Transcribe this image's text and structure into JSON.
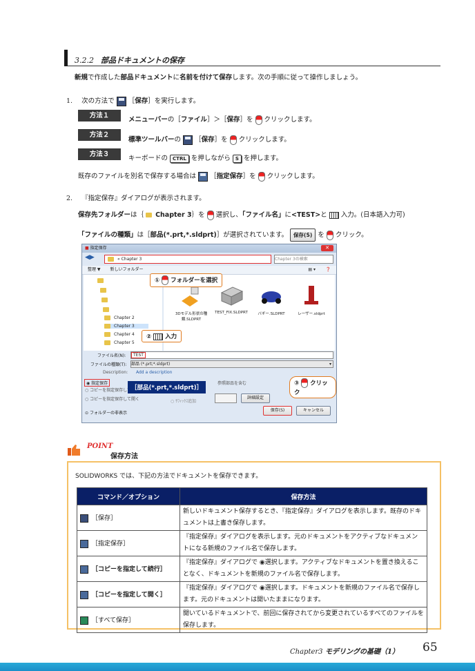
{
  "section": {
    "number": "3.2.2",
    "title": "部品ドキュメントの保存"
  },
  "intro": {
    "p1": "新規",
    "p2": "で作成した",
    "p3": "部品ドキュメント",
    "p4": "に",
    "p5": "名前を付けて保存",
    "p6": "します。次の手順に従って操作しましょう。"
  },
  "step1": {
    "num": "1.",
    "a": "次の方法で",
    "b": "［",
    "c": "保存",
    "d": "］を実行します。",
    "methods": [
      {
        "label": "方法１",
        "t1": "メニューバー",
        "t2": "の［",
        "t3": "ファイル",
        "t4": "］＞［",
        "t5": "保存",
        "t6": "］を",
        "t7": "クリックします。"
      },
      {
        "label": "方法２",
        "t1": "標準ツールバー",
        "t2": "の",
        "t3": "［",
        "t4": "保存",
        "t5": "］を",
        "t6": "クリックします。"
      },
      {
        "label": "方法３",
        "t1": "キーボードの",
        "k1": "CTRL",
        "t2": "を押しながら",
        "k2": "S",
        "t3": "を押します。"
      }
    ],
    "note_a": "既存のファイルを別名で保存する場合は",
    "note_b": "［",
    "note_c": "指定保存",
    "note_d": "］を",
    "note_e": "クリックします。"
  },
  "step2": {
    "num": "2.",
    "line1": "『指定保存』ダイアログが表示されます。",
    "l2a": "保存先フォルダー",
    "l2b": "は｛",
    "l2c": "Chapter 3",
    "l2d": "｝を",
    "l2e": "選択し、",
    "l2f": "「ファイル名」",
    "l2g": "に",
    "l2h": "<TEST>",
    "l2i": "と",
    "l2j": "入力。(日本語入力可)",
    "l3a": "「ファイルの種類」",
    "l3b": "は［",
    "l3c": "部品(*.prt,*.sldprt)",
    "l3d": "］が選択されています。",
    "l3btn": "保存(S)",
    "l3e": "を",
    "l3f": "クリック。"
  },
  "dialog": {
    "title": "指定保存",
    "address": "Chapter 3",
    "search_placeholder": "Chapter 3の検索",
    "organize": "整理 ▼",
    "new_folder": "新しいフォルダー",
    "folders": [
      "Chapter 2",
      "Chapter 3",
      "Chapter 4",
      "Chapter 5"
    ],
    "files": [
      {
        "name": "3Dモデル形状の種類.SLDPRT"
      },
      {
        "name": "TEST_FIX.SLDPRT"
      },
      {
        "name": "バギー.SLDPRT"
      },
      {
        "name": "レーザー.sldprt"
      }
    ],
    "filename_label": "ファイル名(N):",
    "filename_value": "TEST",
    "type_label": "ファイルの種類(T):",
    "type_value": "部品 (*.prt;*.sldprt)",
    "desc_label": "Description:",
    "desc_value": "Add a description",
    "radio1": "指定保存",
    "radio2": "コピーを指定保存して続行",
    "radio3": "コピーを指定保存して開く",
    "include": "参照部品を含む",
    "suffix": "ｻﾌｨｯｸｽ追加",
    "advanced": "詳細設定",
    "hide_folders": "フォルダーの非表示",
    "save_btn": "保存(S)",
    "cancel_btn": "キャンセル",
    "callout1": "フォルダーを選択",
    "callout1_num": "①",
    "callout2": "入力",
    "callout2_num": "②",
    "callout3": "クリック",
    "callout3_num": "③",
    "callout_type": "［部品(*.prt,*.sldprt)］"
  },
  "point": {
    "badge": "POINT",
    "title": "保存方法",
    "intro": "SOLIDWORKS では、下記の方法でドキュメントを保存できます。",
    "head_cmd": "コマンド／オプション",
    "head_desc": "保存方法",
    "rows": [
      {
        "cmd": "［保存］",
        "desc": "新しいドキュメント保存するとき、『指定保存』ダイアログを表示します。既存のドキュメントは上書き保存します。"
      },
      {
        "cmd": "［指定保存］",
        "desc": "『指定保存』ダイアログを表示します。元のドキュメントをアクティブなドキュメントになる新規のファイル名で保存します。"
      },
      {
        "cmd": "［コピーを指定して続行］",
        "desc": "『指定保存』ダイアログで ◉選択します。アクティブなドキュメントを置き換えることなく、ドキュメントを新規のファイル名で保存します。"
      },
      {
        "cmd": "［コピーを指定して開く］",
        "desc": "『指定保存』ダイアログで ◉選択します。ドキュメントを新規のファイル名で保存します。元のドキュメントは開いたままになります。"
      },
      {
        "cmd": "［すべて保存］",
        "desc": "開いているドキュメントで、前回に保存されてから変更されているすべてのファイルを保存します。"
      }
    ]
  },
  "footer": {
    "chapter": "Chapter3",
    "title": "モデリングの基礎（1）",
    "page": "65"
  },
  "colors": {
    "accent_orange": "#f5c064",
    "table_head": "#0a1f66",
    "footer_blue": "#1b8fc9",
    "method_label_bg": "#3a3a3a"
  }
}
